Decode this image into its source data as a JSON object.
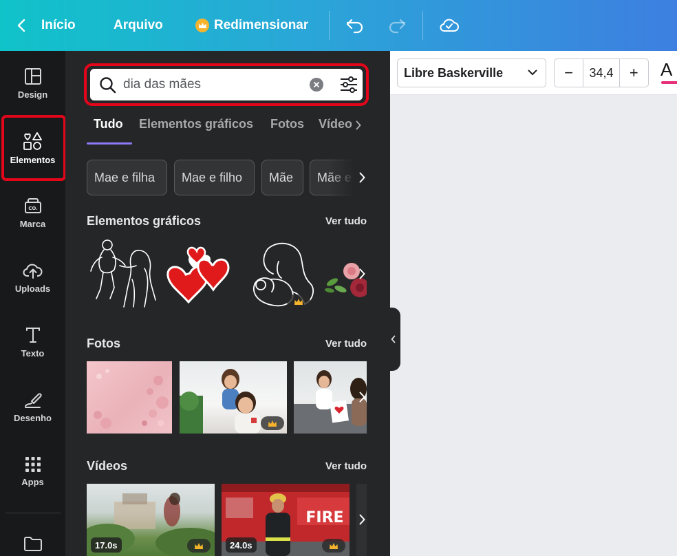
{
  "topbar": {
    "back_label": "Início",
    "file_label": "Arquivo",
    "resize_label": "Redimensionar"
  },
  "rail": {
    "items": [
      {
        "label": "Design"
      },
      {
        "label": "Elementos"
      },
      {
        "label": "Marca"
      },
      {
        "label": "Uploads"
      },
      {
        "label": "Texto"
      },
      {
        "label": "Desenho"
      },
      {
        "label": "Apps"
      }
    ]
  },
  "panel": {
    "search": {
      "value": "dia das mães"
    },
    "tabs": [
      "Tudo",
      "Elementos gráficos",
      "Fotos",
      "Vídeos"
    ],
    "chips": [
      "Mae e filha",
      "Mae e filho",
      "Mãe",
      "Mãe e bebê"
    ],
    "sections": {
      "graphics": {
        "title": "Elementos gráficos",
        "link": "Ver tudo"
      },
      "photos": {
        "title": "Fotos",
        "link": "Ver tudo"
      },
      "videos": {
        "title": "Vídeos",
        "link": "Ver tudo"
      }
    },
    "video_durations": [
      "17.0s",
      "24.0s"
    ],
    "video_text": "FIRE"
  },
  "toolbar": {
    "font": "Libre Baskerville",
    "font_size": "34,4",
    "minus": "−",
    "plus": "+",
    "text_color_glyph": "A"
  },
  "colors": {
    "highlight": "#e3061b",
    "panel_bg": "#252627",
    "rail_bg": "#18191b",
    "tab_underline": "#8b7cf6",
    "text_color_bar": "#e6307a"
  }
}
